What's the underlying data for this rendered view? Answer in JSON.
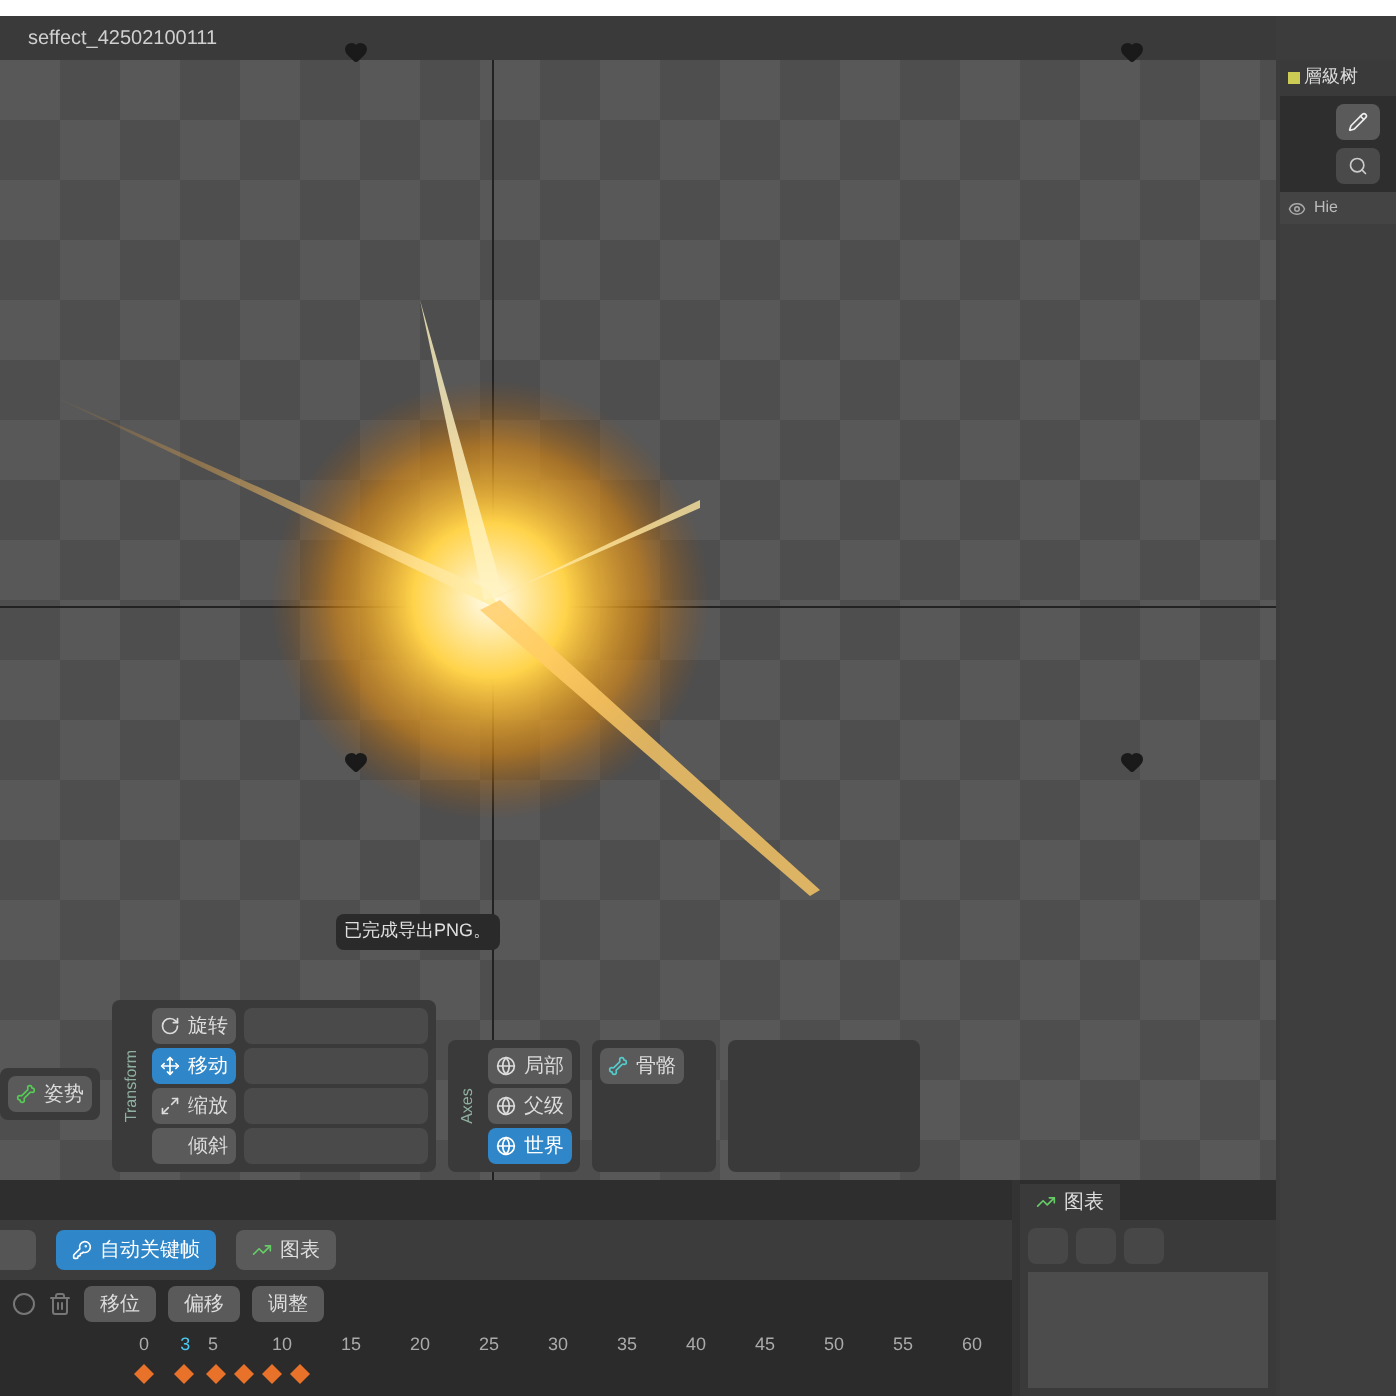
{
  "window": {
    "title": "seffect_42502100111"
  },
  "viewport": {
    "status_message": "已完成导出PNG。"
  },
  "pose_tool": {
    "label": "姿势"
  },
  "transform_tools": {
    "group_label": "Transform",
    "items": [
      {
        "label": "旋转",
        "selected": false
      },
      {
        "label": "移动",
        "selected": true
      },
      {
        "label": "缩放",
        "selected": false
      },
      {
        "label": "倾斜",
        "selected": false
      }
    ]
  },
  "axes": {
    "group_label": "Axes",
    "items": [
      {
        "label": "局部",
        "selected": false
      },
      {
        "label": "父级",
        "selected": false
      },
      {
        "label": "世界",
        "selected": true
      }
    ]
  },
  "create_tools": {
    "items": [
      {
        "label": "骨骼",
        "selected": false
      }
    ]
  },
  "timeline": {
    "auto_key": {
      "label": "自动关键帧",
      "on": true
    },
    "graph_button": "图表",
    "key_buttons": [
      "移位",
      "偏移",
      "调整"
    ],
    "current_frame": "3",
    "ticks": [
      "0",
      "5",
      "10",
      "15",
      "20",
      "25",
      "30",
      "35",
      "40",
      "45",
      "50",
      "55",
      "60"
    ]
  },
  "graph_panel": {
    "tab": "图表"
  },
  "hierarchy": {
    "tab": "層級树",
    "column": "Hie"
  }
}
